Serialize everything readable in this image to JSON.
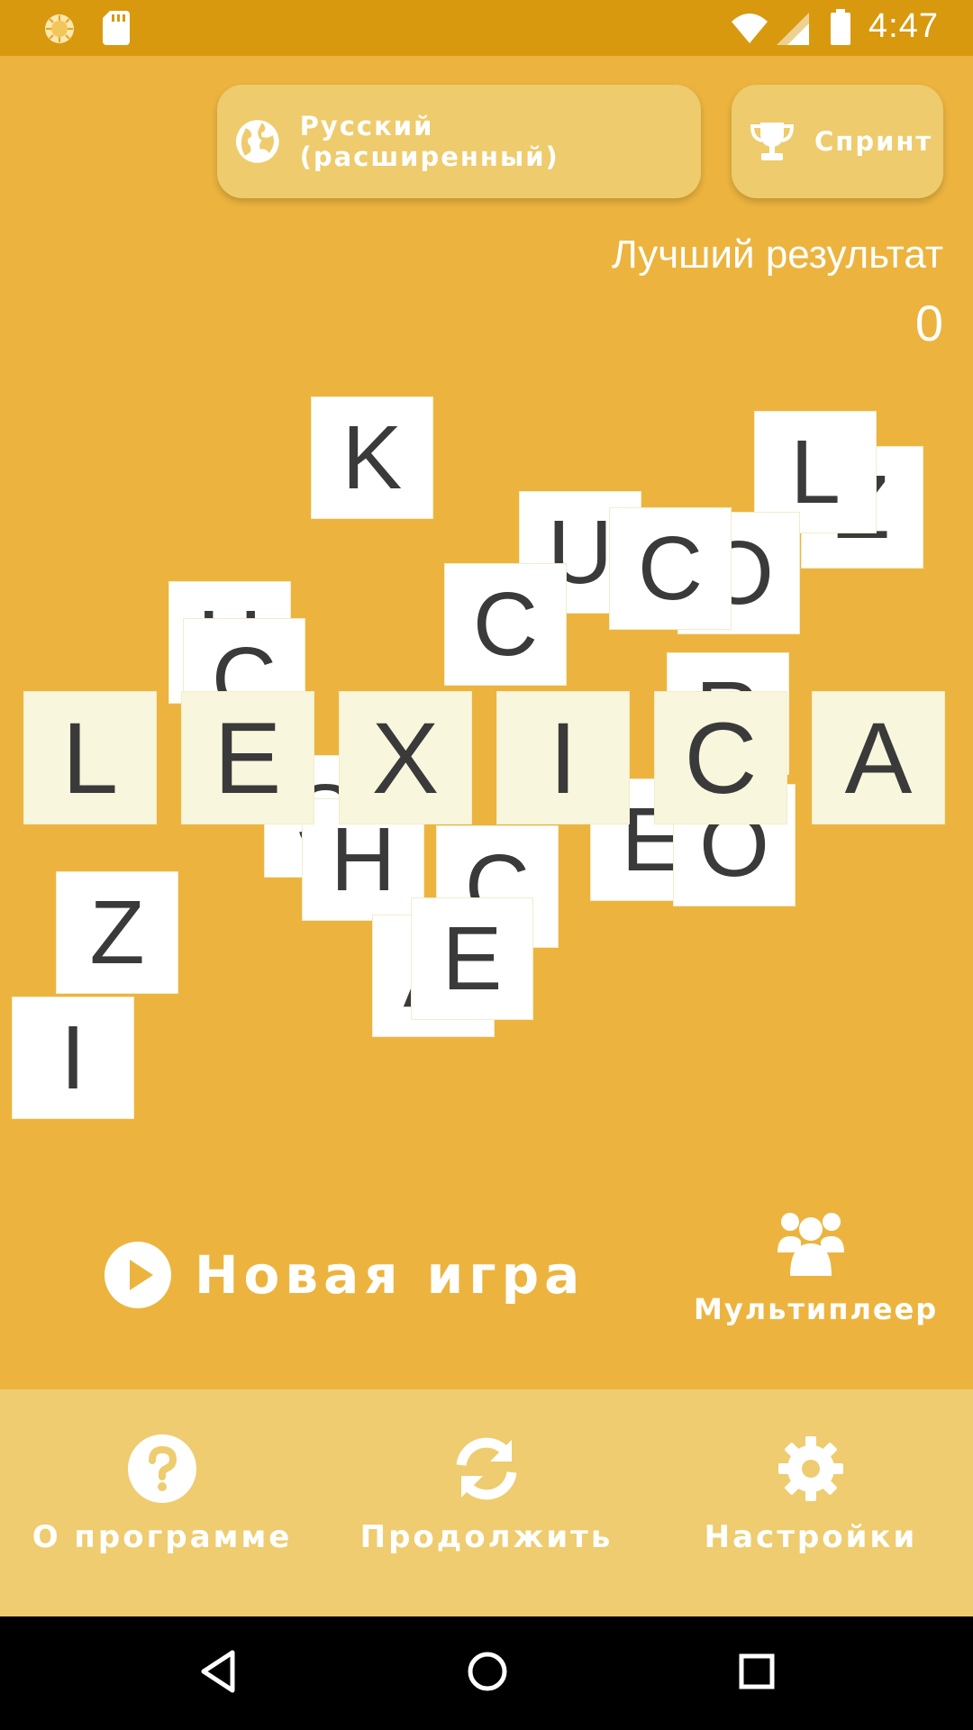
{
  "status_bar": {
    "time": "4:47",
    "icons": [
      "sun-icon",
      "sd-card-icon",
      "wifi-icon",
      "cell-signal-icon",
      "battery-icon"
    ]
  },
  "top_buttons": {
    "language_label": "Русский (расширенный)",
    "language_icon": "globe-icon",
    "mode_label": "Спринт",
    "mode_icon": "trophy-icon"
  },
  "best_result": {
    "label": "Лучший результат",
    "value": "0"
  },
  "title_tiles": [
    "L",
    "E",
    "X",
    "I",
    "C",
    "A"
  ],
  "scattered_tiles": [
    "K",
    "L",
    "Z",
    "U",
    "C",
    "O",
    "C",
    "H",
    "C",
    "R",
    "S",
    "H",
    "C",
    "E",
    "O",
    "Z",
    "A",
    "E",
    "I"
  ],
  "actions": {
    "new_game_label": "Новая игра",
    "new_game_icon": "play-circle-icon",
    "multiplayer_label": "Мультиплеер",
    "multiplayer_icon": "people-group-icon"
  },
  "bottom_menu": {
    "about_label": "О программе",
    "about_icon": "help-circle-icon",
    "continue_label": "Продолжить",
    "continue_icon": "sync-icon",
    "settings_label": "Настройки",
    "settings_icon": "gear-icon"
  },
  "colors": {
    "background": "#ecb43f",
    "status_bar": "#d8990f",
    "panel": "#eecc6f",
    "tile": "#ffffff",
    "tile_highlight": "#f8f6dc"
  },
  "nav_icons": [
    "back-icon",
    "home-icon",
    "recents-icon"
  ]
}
